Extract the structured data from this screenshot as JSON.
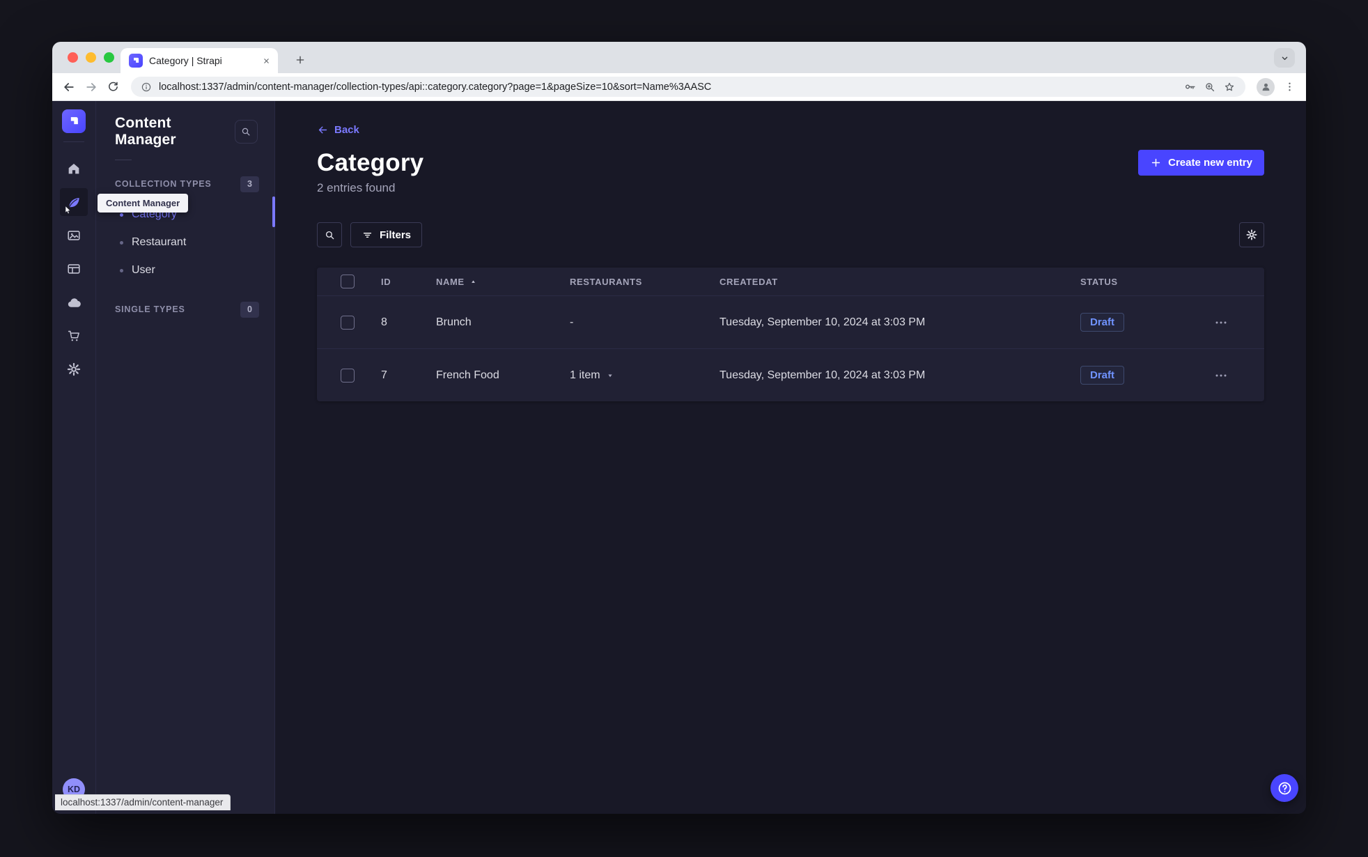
{
  "browser": {
    "tab": {
      "title": "Category | Strapi"
    },
    "url": "localhost:1337/admin/content-manager/collection-types/api::category.category?page=1&pageSize=10&sort=Name%3AASC",
    "status_bar": "localhost:1337/admin/content-manager"
  },
  "sidebar": {
    "tooltip": "Content Manager",
    "user_initials": "KD",
    "items": [
      {
        "name": "home"
      },
      {
        "name": "content-manager",
        "active": true
      },
      {
        "name": "media-library"
      },
      {
        "name": "content-type-builder"
      },
      {
        "name": "deploy-cloud"
      },
      {
        "name": "marketplace"
      },
      {
        "name": "settings"
      }
    ]
  },
  "subnav": {
    "title": "Content Manager",
    "sections": [
      {
        "label": "COLLECTION TYPES",
        "count": "3",
        "items": [
          {
            "label": "Category",
            "active": true
          },
          {
            "label": "Restaurant",
            "active": false
          },
          {
            "label": "User",
            "active": false
          }
        ]
      },
      {
        "label": "SINGLE TYPES",
        "count": "0",
        "items": []
      }
    ]
  },
  "main": {
    "back_label": "Back",
    "title": "Category",
    "subtitle": "2 entries found",
    "create_button_label": "Create new entry",
    "filters_button_label": "Filters",
    "table": {
      "headers": [
        "ID",
        "NAME",
        "RESTAURANTS",
        "CREATEDAT",
        "STATUS"
      ],
      "sort": {
        "column": "NAME",
        "direction": "asc"
      },
      "rows": [
        {
          "id": "8",
          "name": "Brunch",
          "restaurants": "-",
          "createdat": "Tuesday, September 10, 2024 at 3:03 PM",
          "status": "Draft"
        },
        {
          "id": "7",
          "name": "French Food",
          "restaurants": "1 item",
          "createdat": "Tuesday, September 10, 2024 at 3:03 PM",
          "status": "Draft"
        }
      ]
    }
  },
  "colors": {
    "primary": "#4945ff",
    "primary_light": "#7b79ff",
    "app_background": "#181826",
    "panel_background": "#212134",
    "border": "#2a2a43",
    "text_muted": "#a5a5ba",
    "draft_badge_text": "#7093ff",
    "traffic_lights": [
      "#ff5f57",
      "#febc2e",
      "#28c840"
    ]
  },
  "icons": {
    "browser": [
      "back-icon",
      "forward-icon",
      "reload-icon",
      "info-icon",
      "key-icon",
      "zoom-icon",
      "bookmark-star-icon",
      "profile-icon",
      "browser-menu-icon",
      "new-tab-icon",
      "close-tab-icon",
      "tab-search-chevron-icon"
    ],
    "app": [
      "strapi-logo",
      "home-icon",
      "content-manager-feather-icon",
      "media-library-icon",
      "content-type-builder-icon",
      "cloud-icon",
      "marketplace-cart-icon",
      "settings-gear-icon",
      "search-icon",
      "filter-icon",
      "sort-asc-caret-icon",
      "dropdown-caret-icon",
      "row-actions-dots-icon",
      "help-question-icon",
      "cursor-pointer-icon"
    ]
  }
}
